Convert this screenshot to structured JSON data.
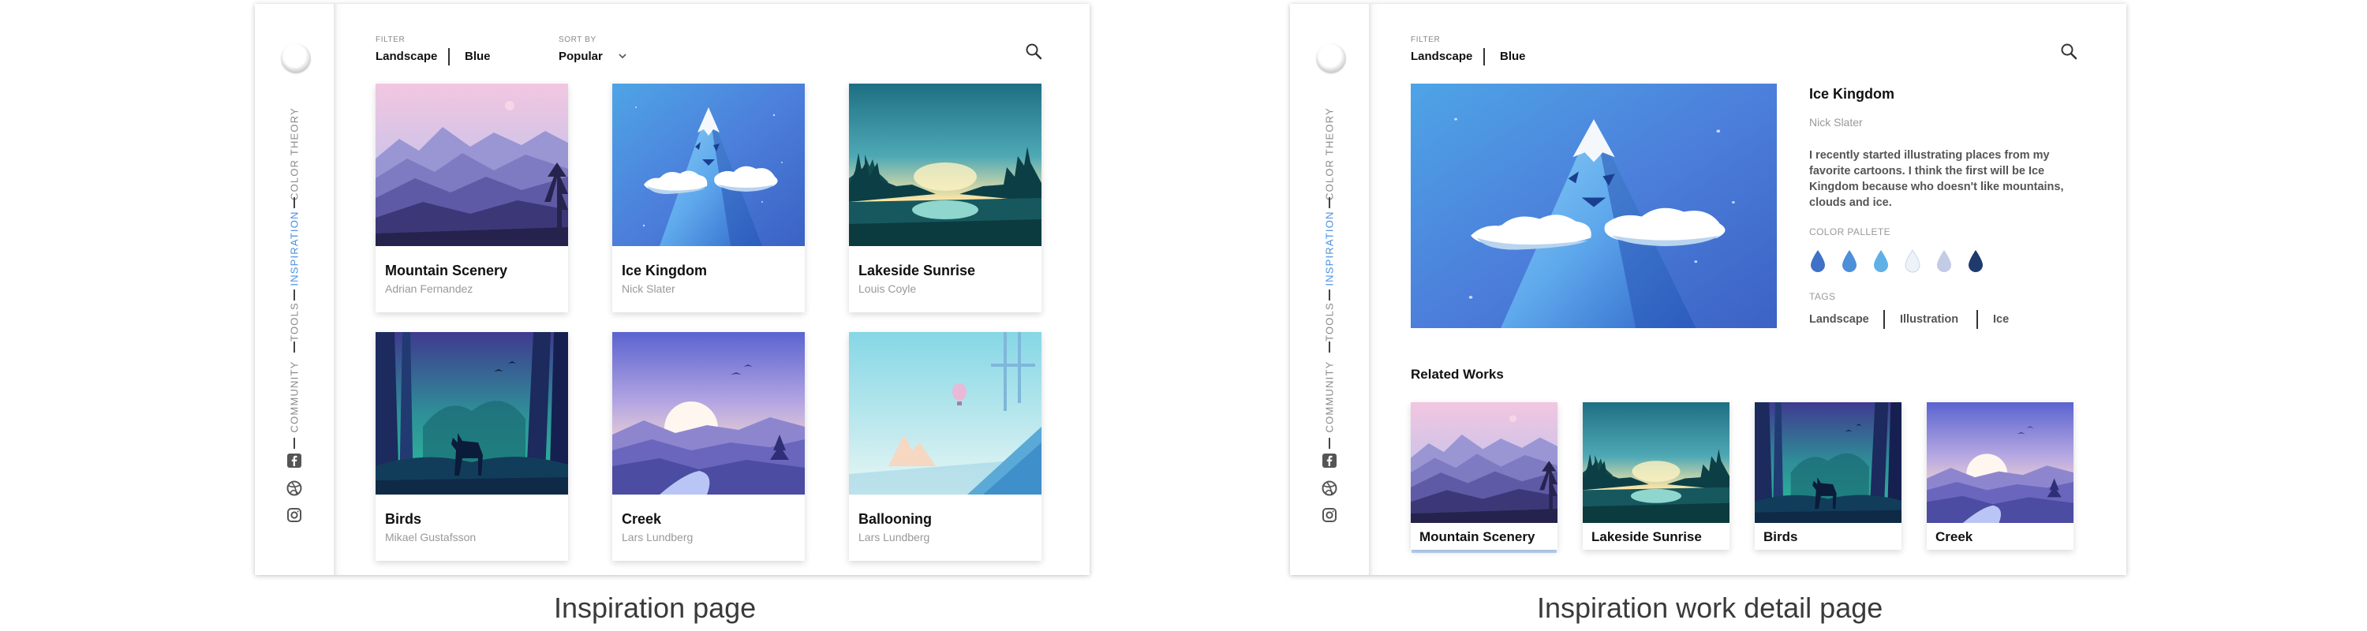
{
  "nav": {
    "items": [
      "COLOR THEORY",
      "INSPIRATION",
      "TOOLS",
      "COMMUNITY"
    ],
    "active": "INSPIRATION",
    "social_icons": [
      "facebook-icon",
      "dribbble-icon",
      "instagram-icon"
    ]
  },
  "filter": {
    "label": "FILTER",
    "values": [
      "Landscape",
      "Blue"
    ]
  },
  "sort": {
    "label": "SORT BY",
    "value": "Popular"
  },
  "inspiration": {
    "caption": "Inspiration page",
    "cards": [
      {
        "title": "Mountain Scenery",
        "author": "Adrian Fernandez"
      },
      {
        "title": "Ice Kingdom",
        "author": "Nick Slater"
      },
      {
        "title": "Lakeside Sunrise",
        "author": "Louis Coyle"
      },
      {
        "title": "Birds",
        "author": "Mikael Gustafsson"
      },
      {
        "title": "Creek",
        "author": "Lars Lundberg"
      },
      {
        "title": "Ballooning",
        "author": "Lars Lundberg"
      }
    ]
  },
  "detail": {
    "caption": "Inspiration work detail page",
    "title": "Ice Kingdom",
    "author": "Nick Slater",
    "description": "I recently started illustrating places from my favorite cartoons. I think the first will be Ice Kingdom because who doesn't like mountains, clouds and ice.",
    "palette_label": "COLOR PALLETE",
    "palette": [
      "#3f72c6",
      "#4d8fd9",
      "#5fb0e6",
      "#eef3f9",
      "#c3cbe6",
      "#1f3b6e"
    ],
    "tags_label": "TAGS",
    "tags": [
      "Landscape",
      "Illustration",
      "Ice"
    ],
    "related_heading": "Related Works",
    "related": [
      "Mountain Scenery",
      "Lakeside Sunrise",
      "Birds",
      "Creek"
    ]
  },
  "colors": {
    "accent": "#4a90e2",
    "text_muted": "#999999"
  }
}
